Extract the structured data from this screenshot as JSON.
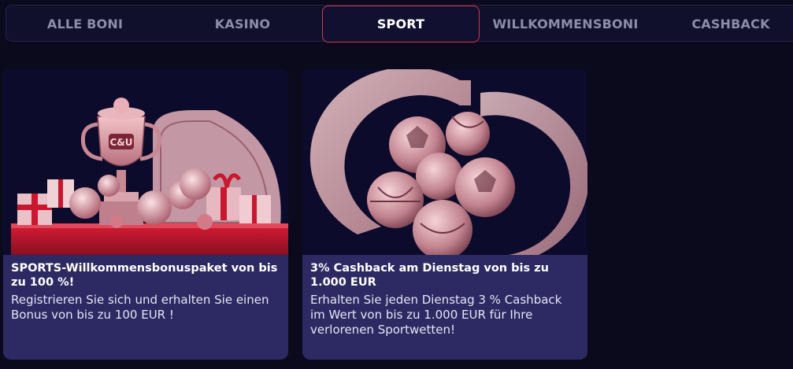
{
  "tabs": [
    {
      "label": "ALLE BONI",
      "active": false
    },
    {
      "label": "KASINO",
      "active": false
    },
    {
      "label": "SPORT",
      "active": true
    },
    {
      "label": "WILLKOMMENSBONI",
      "active": false
    },
    {
      "label": "CASHBACK",
      "active": false
    }
  ],
  "cards": [
    {
      "image_logo": "C&U",
      "title": "SPORTS-Willkommensbonuspaket von bis zu 100 %!",
      "description": "Registrieren Sie sich und erhalten Sie einen Bonus von bis zu 100 EUR !"
    },
    {
      "title": "3% Cashback am Dienstag von bis zu 1.000 EUR",
      "description": "Erhalten Sie jeden Dienstag 3 % Cashback im Wert von bis zu 1.000 EUR für Ihre verlorenen Sportwetten!"
    }
  ],
  "colors": {
    "page_bg": "#0b0a1c",
    "tabbar_bg": "#100f2c",
    "active_border": "#d8364c",
    "card_body_bg": "#2d2a63",
    "card_image_bg": "#0d0b2b"
  }
}
